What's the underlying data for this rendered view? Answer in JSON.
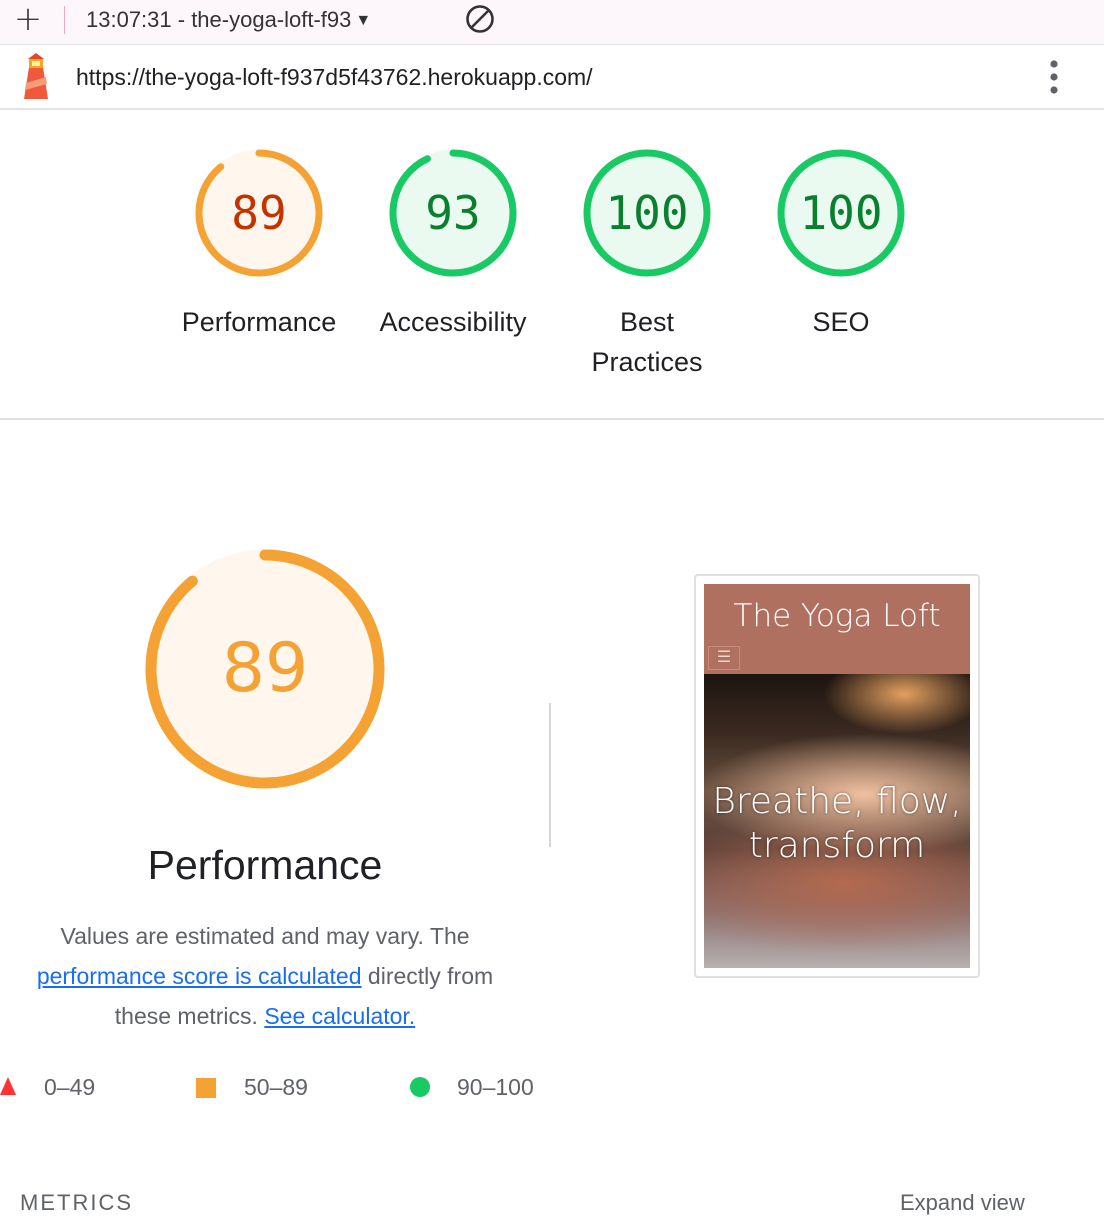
{
  "toolbar": {
    "add_icon": "plus-icon",
    "report_label": "13:07:31 - the-yoga-loft-f93",
    "caret": "▼",
    "clear_icon": "block-icon"
  },
  "urlbar": {
    "logo": "lighthouse-logo",
    "url": "https://the-yoga-loft-f937d5f43762.herokuapp.com/",
    "menu_icon": "kebab-menu-icon"
  },
  "gauges": [
    {
      "score": "89",
      "label": "Performance",
      "value": 0.89,
      "color": "#f4a233",
      "fill": "#fff7ee",
      "text_color": "#c33300"
    },
    {
      "score": "93",
      "label": "Accessibility",
      "value": 0.93,
      "color": "#18c964",
      "fill": "#eafaf1",
      "text_color": "#0a7f2e"
    },
    {
      "score": "100",
      "label": "Best Practices",
      "value": 1.0,
      "color": "#18c964",
      "fill": "#eafaf1",
      "text_color": "#0a7f2e"
    },
    {
      "score": "100",
      "label": "SEO",
      "value": 1.0,
      "color": "#18c964",
      "fill": "#eafaf1",
      "text_color": "#0a7f2e"
    }
  ],
  "performance": {
    "score": "89",
    "value": 0.89,
    "title": "Performance",
    "desc_1": "Values are estimated and may vary. The",
    "link_1": "performance score is calculated",
    "desc_2": "directly from these metrics.",
    "link_2": "See calculator."
  },
  "legend": [
    {
      "range": "0–49",
      "shape": "triangle",
      "color": "#ff3333"
    },
    {
      "range": "50–89",
      "shape": "square",
      "color": "#f4a233"
    },
    {
      "range": "90–100",
      "shape": "circle",
      "color": "#18c964"
    }
  ],
  "screenshot": {
    "brand": "The Yoga Loft",
    "menu_icon": "hamburger-icon",
    "tagline": "Breathe, flow, transform"
  },
  "metrics": {
    "heading": "METRICS",
    "expand": "Expand view"
  }
}
